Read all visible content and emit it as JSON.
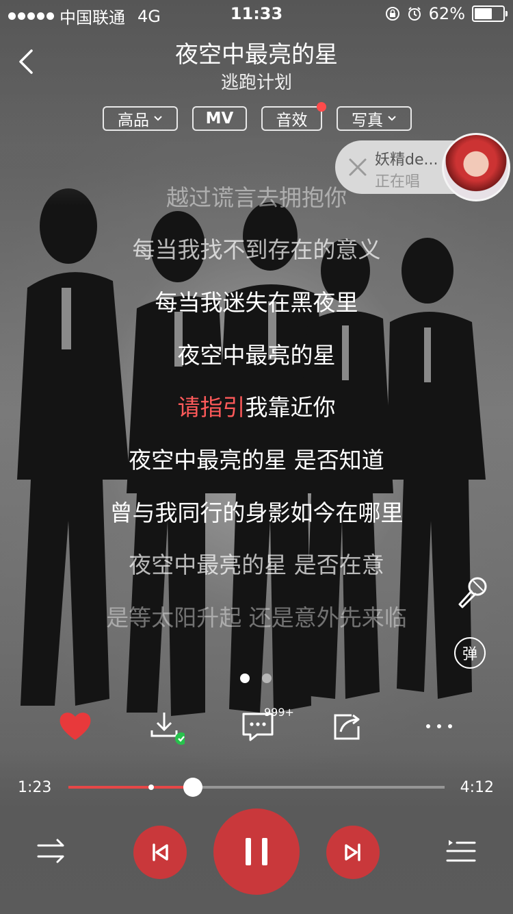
{
  "status_bar": {
    "signal_dots": 5,
    "carrier": "中国联通",
    "network": "4G",
    "time": "11:33",
    "battery_percent": "62%",
    "battery_level": 0.62
  },
  "header": {
    "song_title": "夜空中最亮的星",
    "artist": "逃跑计划"
  },
  "tags": [
    {
      "label": "高品",
      "has_chevron": true,
      "has_dot": false
    },
    {
      "label": "MV",
      "has_chevron": false,
      "has_dot": false
    },
    {
      "label": "音效",
      "has_chevron": false,
      "has_dot": true
    },
    {
      "label": "写真",
      "has_chevron": true,
      "has_dot": false
    }
  ],
  "singing": {
    "name": "妖精de...",
    "status": "正在唱"
  },
  "lyrics": [
    {
      "text": "越过谎言去拥抱你",
      "opacity": 0.45
    },
    {
      "text": "每当我找不到存在的意义",
      "opacity": 0.7
    },
    {
      "text": "每当我迷失在黑夜里",
      "opacity": 1
    },
    {
      "text": "夜空中最亮的星",
      "opacity": 1
    },
    {
      "text": "请指引我靠近你",
      "opacity": 1,
      "current": true,
      "highlight": "请指引",
      "rest": "我靠近你"
    },
    {
      "text": "夜空中最亮的星 是否知道",
      "opacity": 1
    },
    {
      "text": "曾与我同行的身影如今在哪里",
      "opacity": 1
    },
    {
      "text": "夜空中最亮的星 是否在意",
      "opacity": 0.7
    },
    {
      "text": "是等太阳升起 还是意外先来临",
      "opacity": 0.4
    }
  ],
  "side": {
    "danmaku_label": "弹"
  },
  "pager": {
    "count": 2,
    "active": 0
  },
  "actions": {
    "comment_badge": "999+"
  },
  "progress": {
    "current": "1:23",
    "total": "4:12",
    "played_fraction": 0.33,
    "buffered_fraction": 0.22
  },
  "colors": {
    "accent": "#c9383b",
    "lyric_highlight": "#ff5a5a",
    "heart": "#e8393b",
    "download_ok": "#27c24c",
    "dot": "#ff4b4b"
  }
}
